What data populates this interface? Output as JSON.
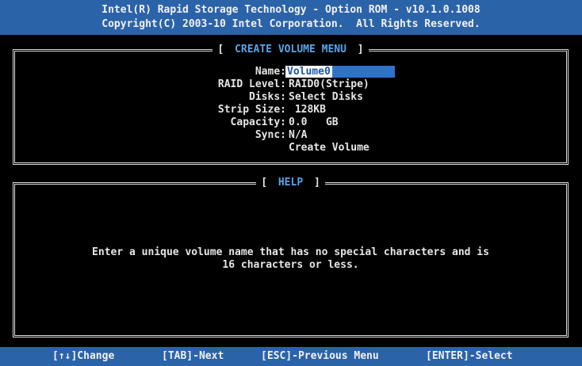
{
  "header": {
    "line1": "Intel(R) Rapid Storage Technology - Option ROM - v10.1.0.1008",
    "line2": "Copyright(C) 2003-10 Intel Corporation.  All Rights Reserved."
  },
  "create_menu": {
    "title": "CREATE VOLUME MENU",
    "fields": {
      "name_label": "Name:",
      "name_value": "Volume0",
      "raid_label": "RAID Level:",
      "raid_value": "RAID0(Stripe)",
      "disks_label": "Disks:",
      "disks_value": "Select Disks",
      "strip_label": "Strip Size:",
      "strip_value": " 128KB",
      "capacity_label": "Capacity:",
      "capacity_value": "0.0   GB",
      "sync_label": "Sync:",
      "sync_value": "N/A",
      "create_action": "Create Volume"
    }
  },
  "help": {
    "title": "HELP",
    "line1": "Enter a unique volume name that has no special characters and is",
    "line2": "16 characters or less."
  },
  "footer": {
    "change": "[↑↓]Change",
    "next": "[TAB]-Next",
    "previous": "[ESC]-Previous Menu",
    "select": "[ENTER]-Select"
  },
  "colors": {
    "bar_background": "#2b63a9",
    "title_accent": "#5aa3e8",
    "screen_background": "#000000"
  }
}
